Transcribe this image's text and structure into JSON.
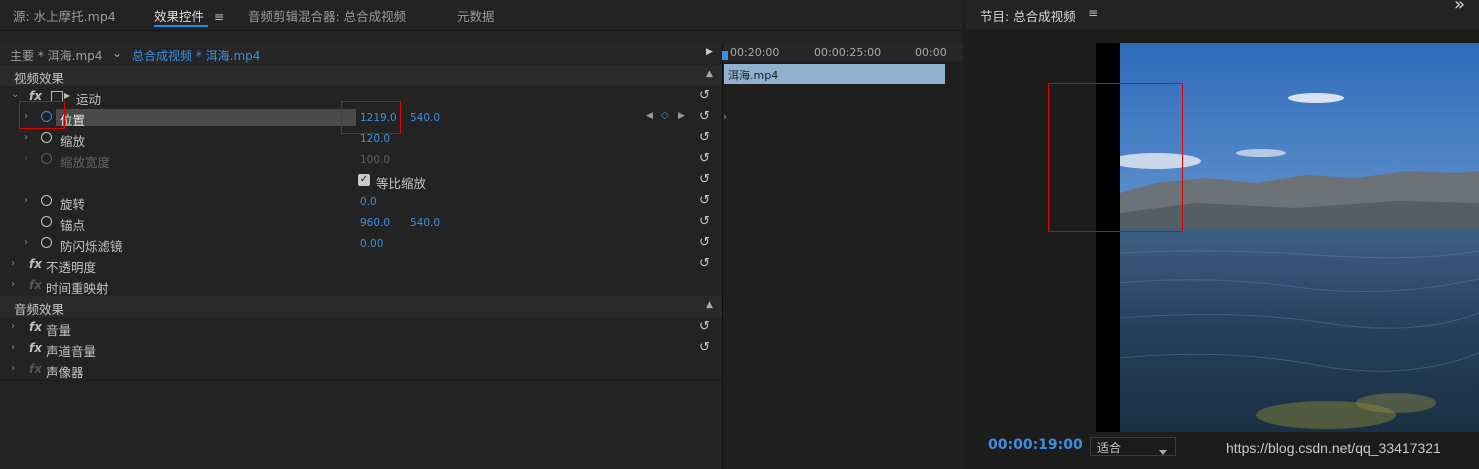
{
  "tabs": [
    {
      "label": "源: 水上摩托.mp4"
    },
    {
      "label": "效果控件"
    },
    {
      "label": "音频剪辑混合器: 总合成视频"
    },
    {
      "label": "元数据"
    }
  ],
  "tab_menu_icon": "hamburger-icon",
  "sequence": {
    "master_label": "主要 * 洱海.mp4",
    "active_label": "总合成视频 * 洱海.mp4"
  },
  "timeline": {
    "time_marks": [
      "00:20:00",
      "00:00:25:00",
      "00:00"
    ],
    "clip_label": "洱海.mp4"
  },
  "video_effects": {
    "header": "视频效果",
    "motion": "运动",
    "position": {
      "label": "位置",
      "x": "1219.0",
      "y": "540.0"
    },
    "scale": {
      "label": "缩放",
      "value": "120.0"
    },
    "scale_width": {
      "label": "缩放宽度",
      "value": "100.0"
    },
    "uniform_scale": {
      "label": "等比缩放",
      "checked": true
    },
    "rotation": {
      "label": "旋转",
      "value": "0.0"
    },
    "anchor": {
      "label": "锚点",
      "x": "960.0",
      "y": "540.0"
    },
    "anti_flicker": {
      "label": "防闪烁滤镜",
      "value": "0.00"
    },
    "opacity": "不透明度",
    "time_remap": "时间重映射"
  },
  "audio_effects": {
    "header": "音频效果",
    "volume": "音量",
    "channel_volume": "声道音量",
    "panner": "声像器"
  },
  "program": {
    "title": "节目: 总合成视频",
    "timecode": "00:00:19:00",
    "fit": "适合",
    "watermark": "https://blog.csdn.net/qq_33417321"
  },
  "colors": {
    "accent": "#2b8cf0",
    "highlight": "#e00000",
    "clip": "#8fb0cf"
  }
}
